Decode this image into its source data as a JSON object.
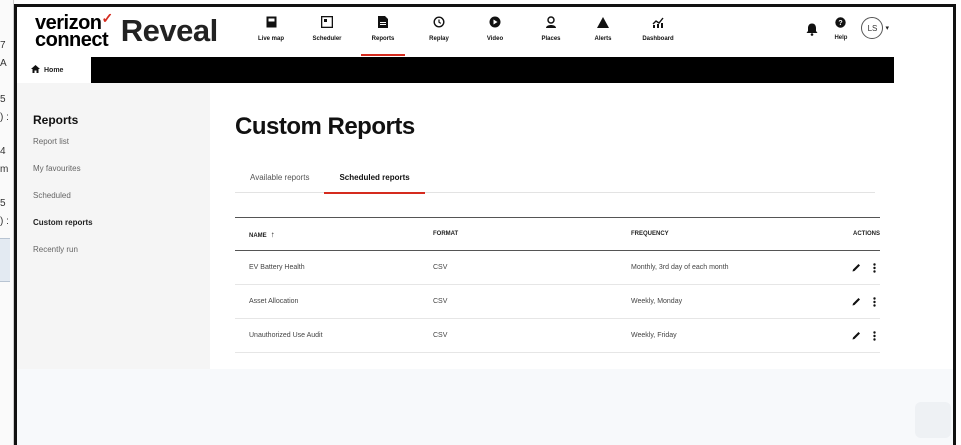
{
  "app": {
    "logo_line1": "verizon",
    "logo_line2": "connect",
    "logo_check": "✓",
    "product": "Reveal",
    "brand_color": "#d52b1e"
  },
  "left_strip": [
    "7",
    "A",
    "5",
    ") :",
    "4",
    "m",
    "5",
    ") :"
  ],
  "nav": [
    {
      "label": "Live map",
      "icon": "live-map-icon",
      "active": false
    },
    {
      "label": "Scheduler",
      "icon": "scheduler-icon",
      "active": false
    },
    {
      "label": "Reports",
      "icon": "reports-icon",
      "active": true
    },
    {
      "label": "Replay",
      "icon": "replay-icon",
      "active": false
    },
    {
      "label": "Video",
      "icon": "video-icon",
      "active": false
    },
    {
      "label": "Places",
      "icon": "places-icon",
      "active": false
    },
    {
      "label": "Alerts",
      "icon": "alerts-icon",
      "active": false
    },
    {
      "label": "Dashboard",
      "icon": "dashboard-icon",
      "active": false
    }
  ],
  "user": {
    "help_label": "Help",
    "initials": "LS"
  },
  "home_tab": "Home",
  "sidebar": {
    "title": "Reports",
    "items": [
      {
        "label": "Report list",
        "active": false
      },
      {
        "label": "My favourites",
        "active": false
      },
      {
        "label": "Scheduled",
        "active": false
      },
      {
        "label": "Custom reports",
        "active": true
      },
      {
        "label": "Recently run",
        "active": false
      }
    ]
  },
  "main": {
    "title": "Custom Reports",
    "tabs": [
      {
        "label": "Available reports",
        "active": false
      },
      {
        "label": "Scheduled reports",
        "active": true
      }
    ],
    "table": {
      "headers": {
        "name": "NAME",
        "format": "FORMAT",
        "frequency": "FREQUENCY",
        "actions": "ACTIONS"
      },
      "sort_indicator": "↑",
      "rows": [
        {
          "name": "EV Battery Health",
          "format": "CSV",
          "frequency": "Monthly, 3rd day of each month"
        },
        {
          "name": "Asset Allocation",
          "format": "CSV",
          "frequency": "Weekly, Monday"
        },
        {
          "name": "Unauthorized Use Audit",
          "format": "CSV",
          "frequency": "Weekly, Friday"
        }
      ]
    }
  }
}
